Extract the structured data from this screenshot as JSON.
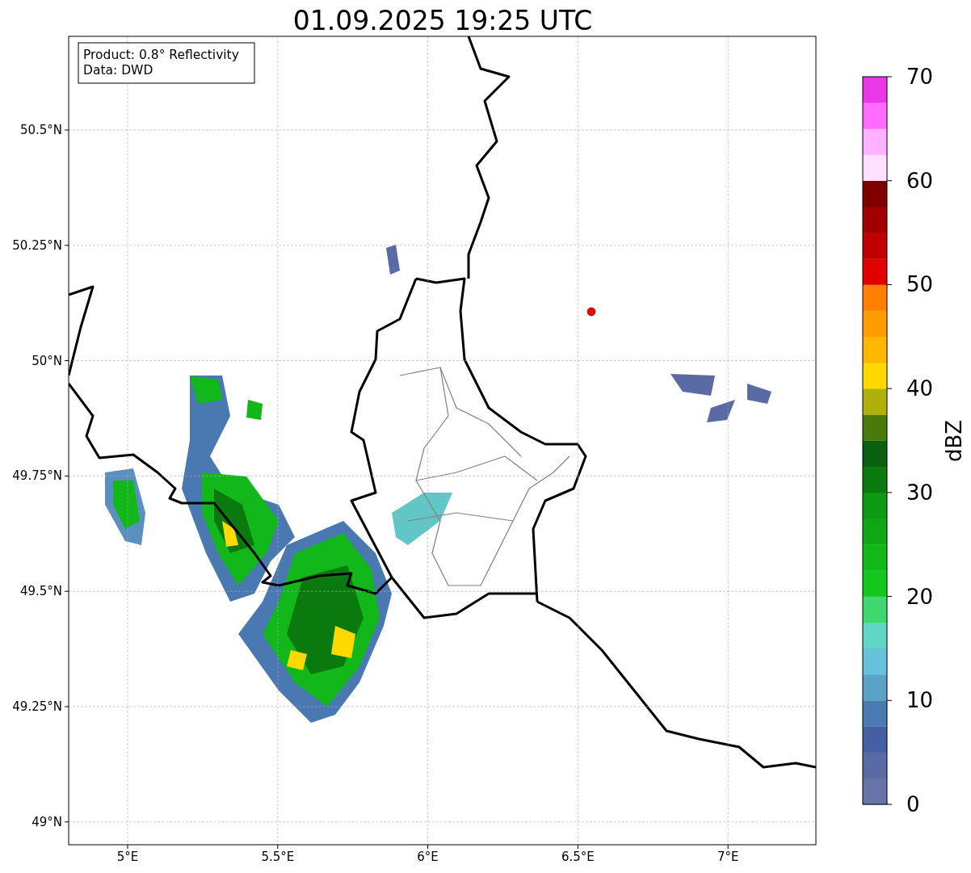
{
  "title": "01.09.2025 19:25 UTC",
  "info_box": [
    "Product: 0.8° Reflectivity",
    "Data: DWD"
  ],
  "map": {
    "lat_ticks": [
      "50.5°N",
      "50.25°N",
      "50°N",
      "49.75°N",
      "49.5°N",
      "49.25°N",
      "49°N"
    ],
    "lon_ticks": [
      "5°E",
      "5.5°E",
      "6°E",
      "6.5°E",
      "7°E"
    ]
  },
  "colorbar": {
    "label": "dBZ",
    "ticks": [
      "70",
      "60",
      "50",
      "40",
      "30",
      "20",
      "10",
      "0"
    ],
    "steps": [
      {
        "color": "#6674a8"
      },
      {
        "color": "#5a6aa4"
      },
      {
        "color": "#4560a2"
      },
      {
        "color": "#4a7ab2"
      },
      {
        "color": "#5aa2c8"
      },
      {
        "color": "#66c2da"
      },
      {
        "color": "#62d6c6"
      },
      {
        "color": "#3ed86e"
      },
      {
        "color": "#12c81a"
      },
      {
        "color": "#10b81a"
      },
      {
        "color": "#0fa814"
      },
      {
        "color": "#0e9a12"
      },
      {
        "color": "#0a7a0e"
      },
      {
        "color": "#086010"
      },
      {
        "color": "#4a7a0c"
      },
      {
        "color": "#b0b00a"
      },
      {
        "color": "#ffd800"
      },
      {
        "color": "#ffb800"
      },
      {
        "color": "#ff9c00"
      },
      {
        "color": "#ff8000"
      },
      {
        "color": "#e00000"
      },
      {
        "color": "#c00000"
      },
      {
        "color": "#a00000"
      },
      {
        "color": "#800000"
      },
      {
        "color": "#ffe0ff"
      },
      {
        "color": "#ffb0ff"
      },
      {
        "color": "#ff6cff"
      },
      {
        "color": "#e838e8"
      }
    ]
  }
}
